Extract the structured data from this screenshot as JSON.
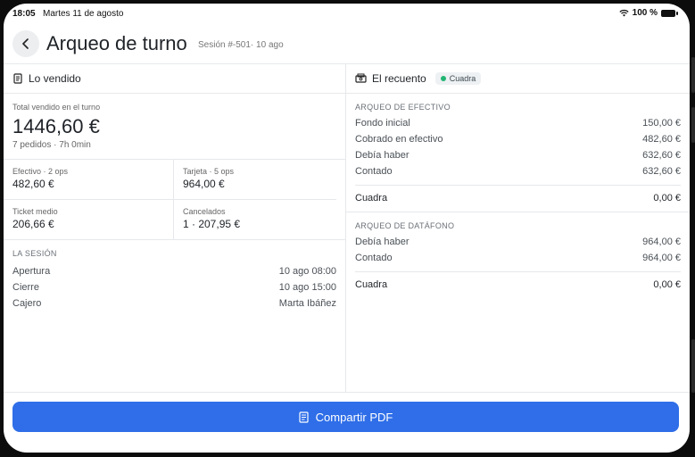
{
  "status": {
    "time": "18:05",
    "date": "Martes 11 de agosto",
    "battery": "100 %"
  },
  "header": {
    "title": "Arqueo de turno",
    "subtitle": "Sesión #-501· 10 ago"
  },
  "sold": {
    "title": "Lo vendido",
    "total_label": "Total vendido en el turno",
    "total_value": "1446,60 €",
    "total_meta": "7 pedidos · 7h 0min",
    "cells": [
      {
        "label": "Efectivo · 2 ops",
        "value": "482,60 €"
      },
      {
        "label": "Tarjeta · 5 ops",
        "value": "964,00 €"
      },
      {
        "label": "Ticket medio",
        "value": "206,66 €"
      },
      {
        "label": "Cancelados",
        "value": "1 · 207,95 €"
      }
    ],
    "session": {
      "title": "LA SESIÓN",
      "rows": [
        {
          "label": "Apertura",
          "value": "10 ago 08:00"
        },
        {
          "label": "Cierre",
          "value": "10 ago 15:00"
        },
        {
          "label": "Cajero",
          "value": "Marta Ibáñez"
        }
      ]
    }
  },
  "count": {
    "title": "El recuento",
    "badge": "Cuadra",
    "cash": {
      "title": "ARQUEO DE EFECTIVO",
      "rows": [
        {
          "label": "Fondo inicial",
          "value": "150,00 €"
        },
        {
          "label": "Cobrado en efectivo",
          "value": "482,60 €"
        },
        {
          "label": "Debía haber",
          "value": "632,60 €"
        },
        {
          "label": "Contado",
          "value": "632,60 €"
        }
      ],
      "result_label": "Cuadra",
      "result_value": "0,00 €"
    },
    "card": {
      "title": "ARQUEO DE DATÁFONO",
      "rows": [
        {
          "label": "Debía haber",
          "value": "964,00 €"
        },
        {
          "label": "Contado",
          "value": "964,00 €"
        }
      ],
      "result_label": "Cuadra",
      "result_value": "0,00 €"
    }
  },
  "footer": {
    "button": "Compartir PDF"
  },
  "colors": {
    "primary": "#2f6ee8",
    "success": "#22b573"
  }
}
